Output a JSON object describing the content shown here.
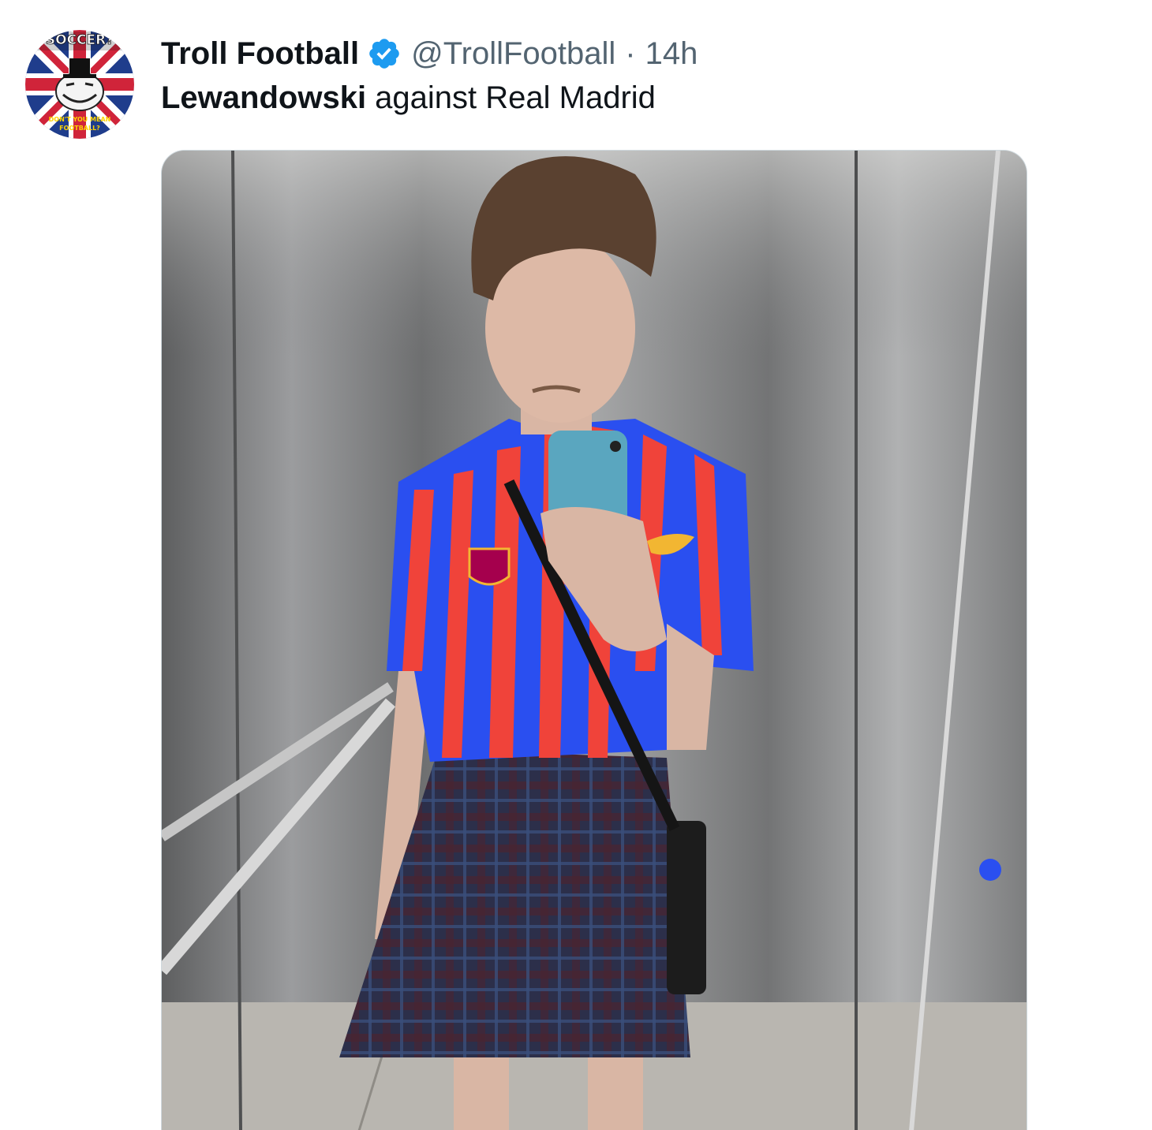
{
  "tweet": {
    "display_name": "Troll Football",
    "handle": "@TrollFootball",
    "separator": "·",
    "time": "14h",
    "text_bold": "Lewandowski",
    "text_rest": " against Real Madrid",
    "avatar": {
      "top_text": "SOCCER?",
      "bottom_text_1": "DON'T YOU MEAN",
      "bottom_text_2": "FOOTBALL?"
    },
    "verified_icon": "verified-badge-icon"
  },
  "media": {
    "description_icon": "photo",
    "colors": {
      "blue": "#2a4ff0",
      "red": "#f0433a",
      "steel": "#8a8c8e",
      "verified": "#1d9bf0"
    }
  }
}
